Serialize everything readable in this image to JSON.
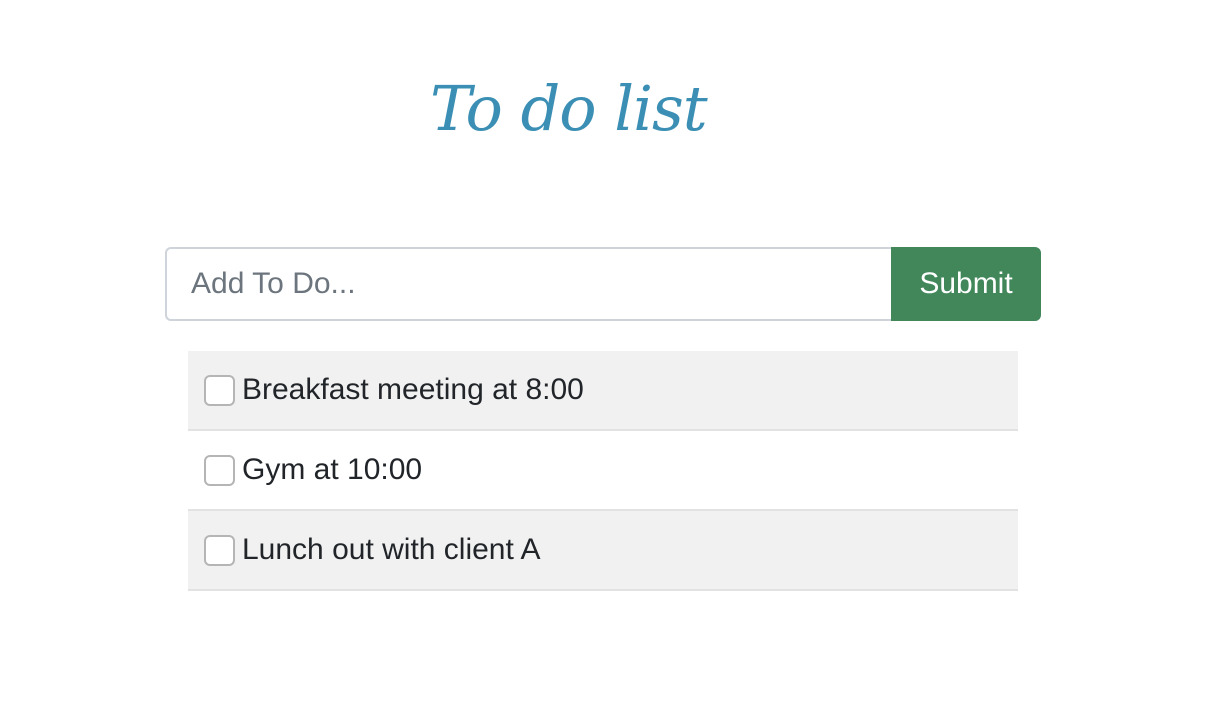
{
  "header": {
    "title": "To do list"
  },
  "form": {
    "input_value": "",
    "input_placeholder": "Add To Do...",
    "submit_label": "Submit"
  },
  "todos": [
    {
      "text": "Breakfast meeting at 8:00",
      "checked": false
    },
    {
      "text": "Gym at 10:00",
      "checked": false
    },
    {
      "text": "Lunch out with client A",
      "checked": false
    }
  ],
  "colors": {
    "title": "#3b8fb4",
    "submit_background": "#41875a",
    "row_shade": "#f1f1f1"
  }
}
